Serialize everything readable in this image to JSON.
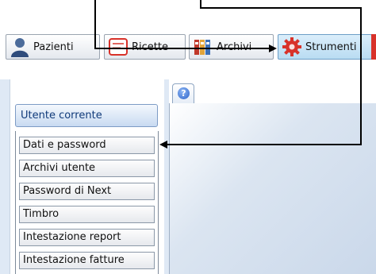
{
  "toolbar": {
    "buttons": [
      {
        "label": "Pazienti",
        "icon": "person-icon"
      },
      {
        "label": "Ricette",
        "icon": "prescription-icon"
      },
      {
        "label": "Archivi",
        "icon": "binders-icon"
      },
      {
        "label": "Strumenti",
        "icon": "gear-icon",
        "active": true
      }
    ]
  },
  "sidebar": {
    "header": "Utente corrente",
    "items": [
      {
        "label": "Dati e password"
      },
      {
        "label": "Archivi utente"
      },
      {
        "label": "Password di Next"
      },
      {
        "label": "Timbro"
      },
      {
        "label": "Intestazione report"
      },
      {
        "label": "Intestazione fatture"
      }
    ]
  },
  "tabs": {
    "help_icon": "help-icon"
  },
  "colors": {
    "accent": "#d8322a",
    "panel": "#dfe9f5",
    "active_button": "#b9dcf2"
  }
}
